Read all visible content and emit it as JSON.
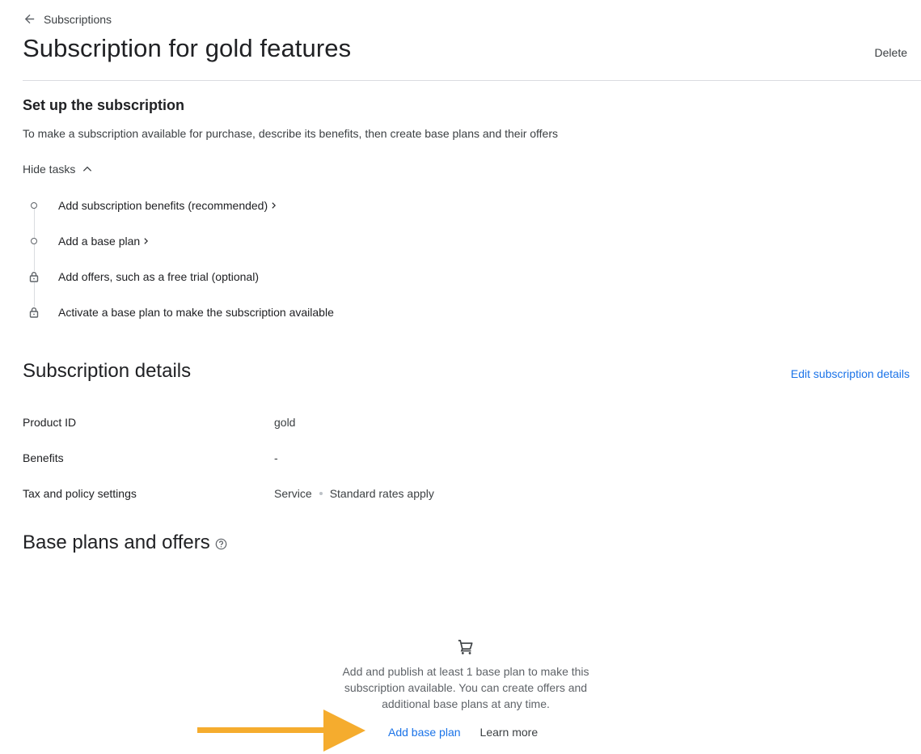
{
  "header": {
    "back_label": "Subscriptions",
    "title": "Subscription for gold features",
    "delete_label": "Delete"
  },
  "setup": {
    "title": "Set up the subscription",
    "description": "To make a subscription available for purchase, describe its benefits, then create base plans and their offers",
    "hide_tasks_label": "Hide tasks",
    "tasks": [
      {
        "label": "Add subscription benefits (recommended)",
        "icon": "circle-icon",
        "has_chevron": true
      },
      {
        "label": "Add a base plan",
        "icon": "circle-icon",
        "has_chevron": true
      },
      {
        "label": "Add offers, such as a free trial (optional)",
        "icon": "lock-icon",
        "has_chevron": false
      },
      {
        "label": "Activate a base plan to make the subscription available",
        "icon": "lock-icon",
        "has_chevron": false
      }
    ]
  },
  "details": {
    "title": "Subscription details",
    "edit_label": "Edit subscription details",
    "rows": [
      {
        "label": "Product ID",
        "value": "gold"
      },
      {
        "label": "Benefits",
        "value": "-"
      },
      {
        "label": "Tax and policy settings",
        "value": "Service",
        "value_secondary": "Standard rates apply"
      }
    ]
  },
  "plans": {
    "title": "Base plans and offers",
    "help_icon": "help-circle-icon",
    "empty_icon": "shopping-cart-icon",
    "empty_text_lines": [
      "Add and publish at least 1 base plan to make this",
      "subscription available. You can create offers and",
      "additional base plans at any time."
    ],
    "add_label": "Add base plan",
    "learn_more_label": "Learn more"
  },
  "annotation": {
    "arrow_color": "#F5AC2E"
  },
  "colors": {
    "link": "#1a73e8",
    "text": "#202124",
    "divider": "#dadce0"
  }
}
